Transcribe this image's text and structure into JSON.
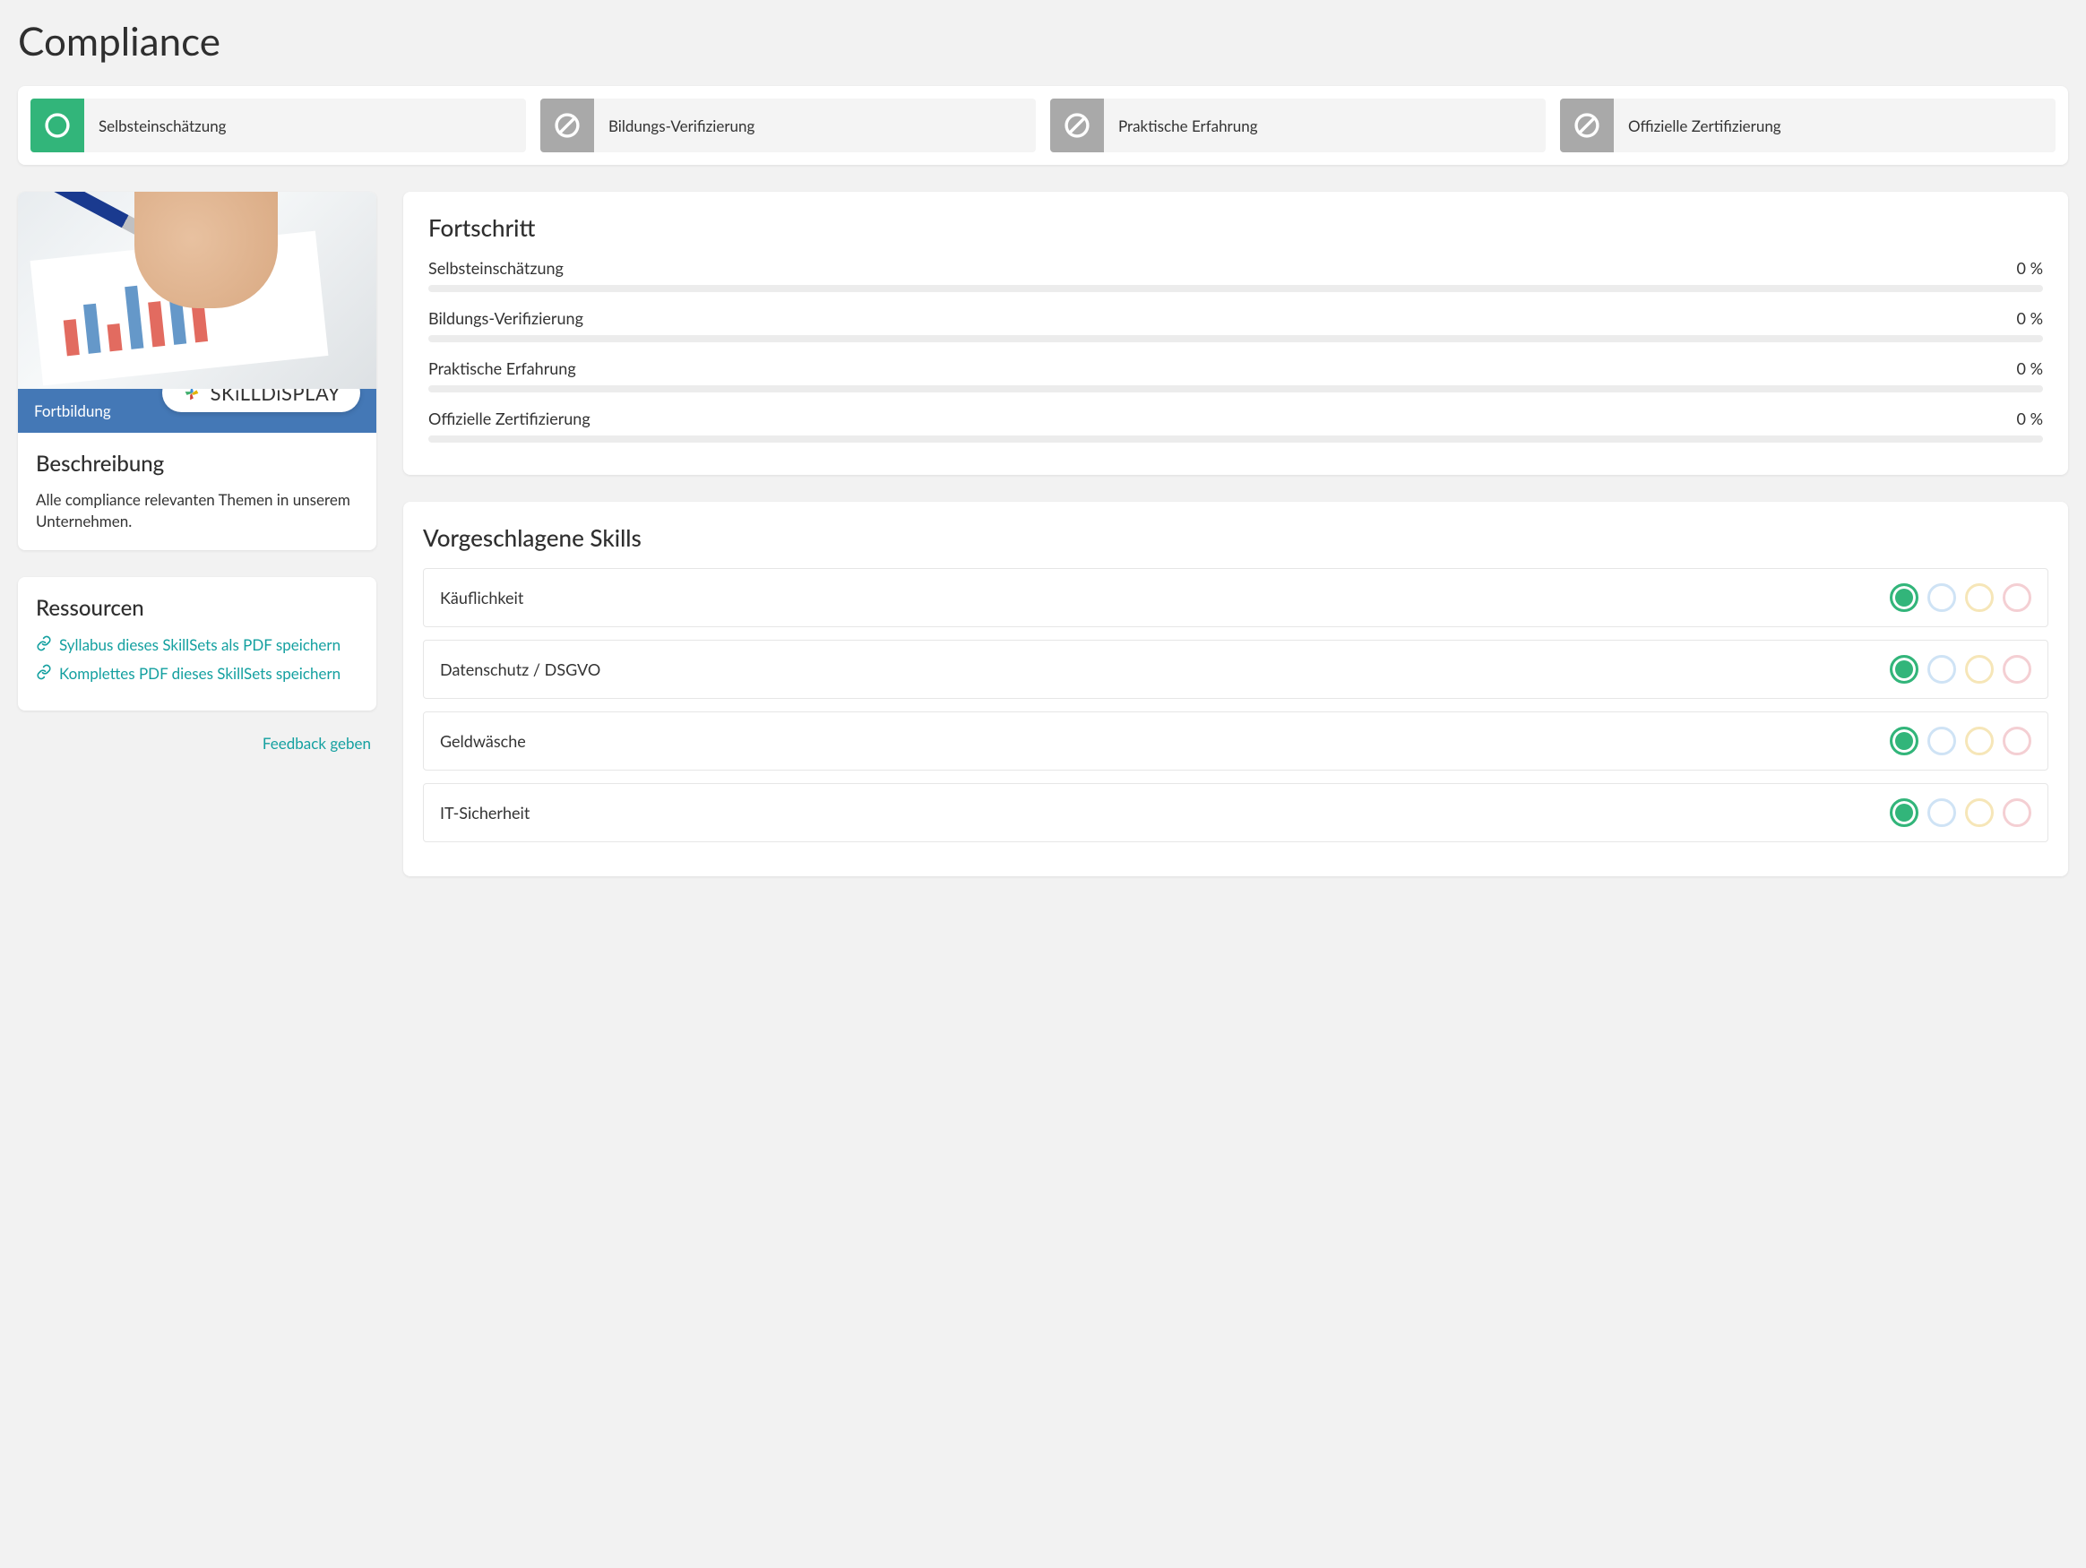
{
  "title": "Compliance",
  "verification_types": [
    {
      "label": "Selbsteinschätzung",
      "iconColor": "green",
      "icon": "circle"
    },
    {
      "label": "Bildungs-Verifizierung",
      "iconColor": "gray",
      "icon": "slash"
    },
    {
      "label": "Praktische Erfahrung",
      "iconColor": "gray",
      "icon": "slash"
    },
    {
      "label": "Offizielle Zertifizierung",
      "iconColor": "gray",
      "icon": "slash"
    }
  ],
  "hero": {
    "category": "Fortbildung",
    "brand": "SKiLLDiSPLAY",
    "desc_heading": "Beschreibung",
    "desc_text": "Alle compliance relevanten Themen in unserem Unternehmen."
  },
  "resources": {
    "heading": "Ressourcen",
    "links": [
      {
        "label": "Syllabus dieses SkillSets als PDF speichern"
      },
      {
        "label": "Komplettes PDF dieses SkillSets speichern"
      }
    ]
  },
  "feedback_label": "Feedback geben",
  "progress": {
    "heading": "Fortschritt",
    "items": [
      {
        "label": "Selbsteinschätzung",
        "value": "0 %",
        "pct": 0
      },
      {
        "label": "Bildungs-Verifizierung",
        "value": "0 %",
        "pct": 0
      },
      {
        "label": "Praktische Erfahrung",
        "value": "0 %",
        "pct": 0
      },
      {
        "label": "Offizielle Zertifizierung",
        "value": "0 %",
        "pct": 0
      }
    ]
  },
  "skills": {
    "heading": "Vorgeschlagene Skills",
    "items": [
      {
        "name": "Käuflichkeit"
      },
      {
        "name": "Datenschutz / DSGVO"
      },
      {
        "name": "Geldwäsche"
      },
      {
        "name": "IT-Sicherheit"
      }
    ]
  },
  "colors": {
    "accent_teal": "#14a0a0",
    "accent_green": "#32b57a",
    "ribbon_blue": "#4478b6",
    "badge_blue": "#cfe3f5",
    "badge_yellow": "#f6e6b8",
    "badge_pink": "#f4cfd3"
  }
}
